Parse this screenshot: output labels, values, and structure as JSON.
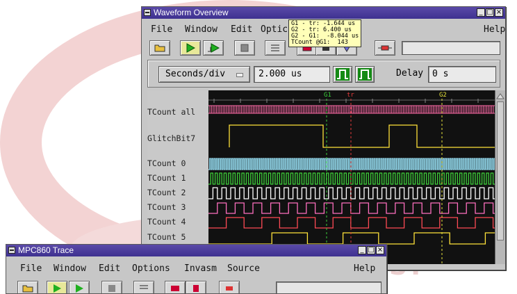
{
  "waveform_window": {
    "title": "Waveform Overview",
    "menu": [
      "File",
      "Window",
      "Edit",
      "Optic",
      "Help"
    ],
    "timebase": {
      "unit_button": "Seconds/div",
      "value": "2.000 us",
      "delay_label": "Delay",
      "delay_value": "0 s"
    },
    "markers": {
      "g1": "G1",
      "tr": "tr",
      "g2": "G2"
    },
    "tooltip": [
      "G1 - tr: -1.644 us",
      "G2 - tr: 6.400 us",
      "G2 - G1:  -8.044 us",
      "TCount @G1:  143"
    ],
    "signals": [
      {
        "label": "TCount all"
      },
      {
        "label": "GlitchBit7"
      },
      {
        "label": "TCount   0"
      },
      {
        "label": "TCount   1"
      },
      {
        "label": "TCount   2"
      },
      {
        "label": "TCount   3"
      },
      {
        "label": "TCount   4"
      },
      {
        "label": "TCount   5"
      }
    ]
  },
  "trace_window": {
    "title": "MPC860 Trace",
    "menu": [
      "File",
      "Window",
      "Edit",
      "Options",
      "Invasm",
      "Source",
      "Help"
    ]
  },
  "colors": {
    "title_bar": "#3e3190",
    "tcount0": "#8fd3e6",
    "tcount1": "#3ed03a",
    "tcount2": "#ffffff",
    "tcount3": "#ff6fbf",
    "tcount4": "#ff4a55",
    "tcount5": "#ffe23a",
    "tcount_all": "#ff6aa8",
    "glitch": "#ffe23a"
  }
}
